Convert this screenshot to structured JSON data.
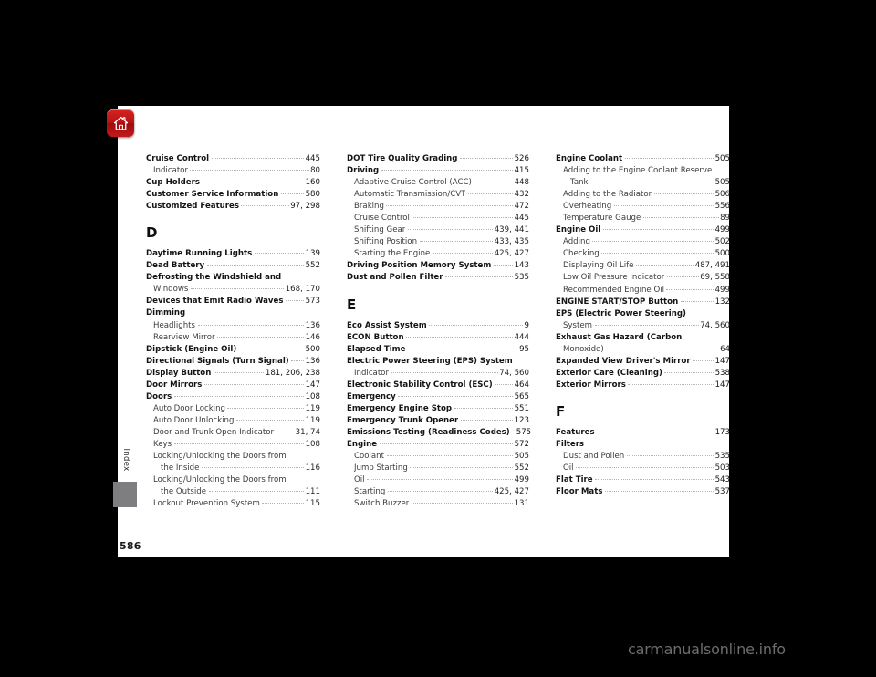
{
  "page": {
    "number": "586",
    "side_tab_label": "Index",
    "watermark": "carmanualsonline.info",
    "home_icon": "home-icon"
  },
  "columns": [
    {
      "id": "column-1",
      "blocks": [
        {
          "type": "entries",
          "entries": [
            {
              "level": 0,
              "text": "Cruise Control",
              "page": "445"
            },
            {
              "level": 1,
              "text": "Indicator",
              "page": "80"
            },
            {
              "level": 0,
              "text": "Cup Holders",
              "page": "160"
            },
            {
              "level": 0,
              "text": "Customer Service Information",
              "page": "580"
            },
            {
              "level": 0,
              "text": "Customized Features",
              "page": "97, 298"
            }
          ]
        },
        {
          "type": "heading",
          "letter": "D"
        },
        {
          "type": "entries",
          "entries": [
            {
              "level": 0,
              "text": "Daytime Running Lights",
              "page": "139"
            },
            {
              "level": 0,
              "text": "Dead Battery",
              "page": "552"
            },
            {
              "level": 0,
              "text": "Defrosting the Windshield and",
              "page": ""
            },
            {
              "level": 1,
              "text": "Windows",
              "page": "168, 170"
            },
            {
              "level": 0,
              "text": "Devices that Emit Radio Waves",
              "page": "573"
            },
            {
              "level": 0,
              "text": "Dimming",
              "page": ""
            },
            {
              "level": 1,
              "text": "Headlights",
              "page": "136"
            },
            {
              "level": 1,
              "text": "Rearview Mirror",
              "page": "146"
            },
            {
              "level": 0,
              "text": "Dipstick (Engine Oil)",
              "page": "500"
            },
            {
              "level": 0,
              "text": "Directional Signals (Turn Signal)",
              "page": "136"
            },
            {
              "level": 0,
              "text": "Display Button",
              "page": "181, 206, 238"
            },
            {
              "level": 0,
              "text": "Door Mirrors",
              "page": "147"
            },
            {
              "level": 0,
              "text": "Doors",
              "page": "108"
            },
            {
              "level": 1,
              "text": "Auto Door Locking",
              "page": "119"
            },
            {
              "level": 1,
              "text": "Auto Door Unlocking",
              "page": "119"
            },
            {
              "level": 1,
              "text": "Door and Trunk Open Indicator",
              "page": "31, 74"
            },
            {
              "level": 1,
              "text": "Keys",
              "page": "108"
            },
            {
              "level": 1,
              "text": "Locking/Unlocking the Doors from",
              "page": ""
            },
            {
              "level": 2,
              "text": "the Inside",
              "page": "116"
            },
            {
              "level": 1,
              "text": "Locking/Unlocking the Doors from",
              "page": ""
            },
            {
              "level": 2,
              "text": "the Outside",
              "page": "111"
            },
            {
              "level": 1,
              "text": "Lockout Prevention System",
              "page": "115"
            }
          ]
        }
      ]
    },
    {
      "id": "column-2",
      "blocks": [
        {
          "type": "entries",
          "entries": [
            {
              "level": 0,
              "text": "DOT Tire Quality Grading",
              "page": "526"
            },
            {
              "level": 0,
              "text": "Driving",
              "page": "415"
            },
            {
              "level": 1,
              "text": "Adaptive Cruise Control (ACC)",
              "page": "448"
            },
            {
              "level": 1,
              "text": "Automatic Transmission/CVT",
              "page": "432"
            },
            {
              "level": 1,
              "text": "Braking",
              "page": "472"
            },
            {
              "level": 1,
              "text": "Cruise Control",
              "page": "445"
            },
            {
              "level": 1,
              "text": "Shifting Gear",
              "page": "439, 441"
            },
            {
              "level": 1,
              "text": "Shifting Position",
              "page": "433, 435"
            },
            {
              "level": 1,
              "text": "Starting the Engine",
              "page": "425, 427"
            },
            {
              "level": 0,
              "text": "Driving Position Memory System",
              "page": "143"
            },
            {
              "level": 0,
              "text": "Dust and Pollen Filter",
              "page": "535"
            }
          ]
        },
        {
          "type": "heading",
          "letter": "E"
        },
        {
          "type": "entries",
          "entries": [
            {
              "level": 0,
              "text": "Eco Assist System",
              "page": "9"
            },
            {
              "level": 0,
              "text": "ECON Button",
              "page": "444"
            },
            {
              "level": 0,
              "text": "Elapsed Time",
              "page": "95"
            },
            {
              "level": 0,
              "text": "Electric Power Steering (EPS) System",
              "page": ""
            },
            {
              "level": 1,
              "text": "Indicator",
              "page": "74, 560"
            },
            {
              "level": 0,
              "text": "Electronic Stability Control (ESC)",
              "page": "464"
            },
            {
              "level": 0,
              "text": "Emergency",
              "page": "565"
            },
            {
              "level": 0,
              "text": "Emergency Engine Stop",
              "page": "551"
            },
            {
              "level": 0,
              "text": "Emergency Trunk Opener",
              "page": "123"
            },
            {
              "level": 0,
              "text": "Emissions Testing (Readiness Codes)",
              "page": "575"
            },
            {
              "level": 0,
              "text": "Engine",
              "page": "572"
            },
            {
              "level": 1,
              "text": "Coolant",
              "page": "505"
            },
            {
              "level": 1,
              "text": "Jump Starting",
              "page": "552"
            },
            {
              "level": 1,
              "text": "Oil",
              "page": "499"
            },
            {
              "level": 1,
              "text": "Starting",
              "page": "425, 427"
            },
            {
              "level": 1,
              "text": "Switch Buzzer",
              "page": "131"
            }
          ]
        }
      ]
    },
    {
      "id": "column-3",
      "blocks": [
        {
          "type": "entries",
          "entries": [
            {
              "level": 0,
              "text": "Engine Coolant",
              "page": "505"
            },
            {
              "level": 1,
              "text": "Adding to the Engine Coolant Reserve",
              "page": ""
            },
            {
              "level": 2,
              "text": "Tank",
              "page": "505"
            },
            {
              "level": 1,
              "text": "Adding to the Radiator",
              "page": "506"
            },
            {
              "level": 1,
              "text": "Overheating",
              "page": "556"
            },
            {
              "level": 1,
              "text": "Temperature Gauge",
              "page": "89"
            },
            {
              "level": 0,
              "text": "Engine Oil",
              "page": "499"
            },
            {
              "level": 1,
              "text": "Adding",
              "page": "502"
            },
            {
              "level": 1,
              "text": "Checking",
              "page": "500"
            },
            {
              "level": 1,
              "text": "Displaying Oil Life",
              "page": "487, 491"
            },
            {
              "level": 1,
              "text": "Low Oil Pressure Indicator",
              "page": "69, 558"
            },
            {
              "level": 1,
              "text": "Recommended Engine Oil",
              "page": "499"
            },
            {
              "level": 0,
              "text": "ENGINE START/STOP Button",
              "page": "132"
            },
            {
              "level": 0,
              "text": "EPS (Electric Power Steering)",
              "page": ""
            },
            {
              "level": 1,
              "text": "System",
              "page": "74, 560"
            },
            {
              "level": 0,
              "text": "Exhaust Gas Hazard (Carbon",
              "page": ""
            },
            {
              "level": 1,
              "text": "Monoxide)",
              "page": "64"
            },
            {
              "level": 0,
              "text": "Expanded View Driver's Mirror",
              "page": "147"
            },
            {
              "level": 0,
              "text": "Exterior Care (Cleaning)",
              "page": "538"
            },
            {
              "level": 0,
              "text": "Exterior Mirrors",
              "page": "147"
            }
          ]
        },
        {
          "type": "heading",
          "letter": "F"
        },
        {
          "type": "entries",
          "entries": [
            {
              "level": 0,
              "text": "Features",
              "page": "173"
            },
            {
              "level": 0,
              "text": "Filters",
              "page": ""
            },
            {
              "level": 1,
              "text": "Dust and Pollen",
              "page": "535"
            },
            {
              "level": 1,
              "text": "Oil",
              "page": "503"
            },
            {
              "level": 0,
              "text": "Flat Tire",
              "page": "543"
            },
            {
              "level": 0,
              "text": "Floor Mats",
              "page": "537"
            }
          ]
        }
      ]
    }
  ],
  "colors": {
    "page_background": "#ffffff",
    "canvas_background": "#000000",
    "home_button_red": "#c31a1a",
    "tab_gray": "#7e7e80",
    "text": "#231f20",
    "watermark": "#6d6d6d"
  }
}
